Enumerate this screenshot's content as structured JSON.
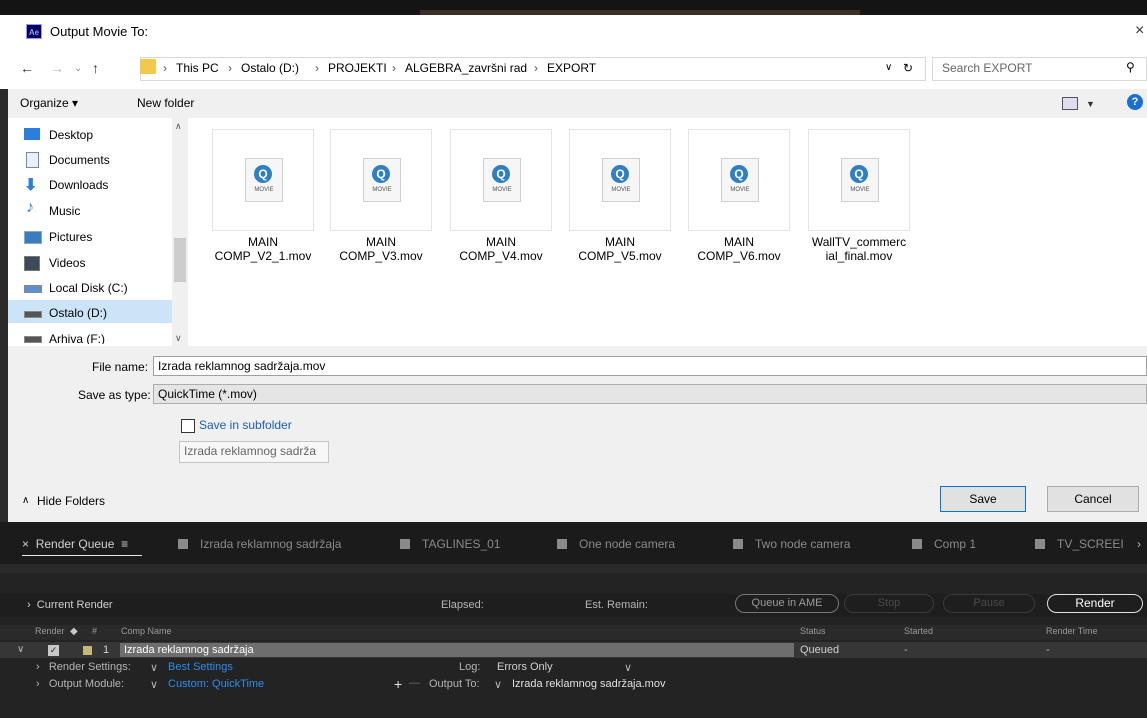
{
  "dialog": {
    "title": "Output Movie To:",
    "logo_text": "Ae",
    "close": "×",
    "breadcrumbs": [
      "This PC",
      "Ostalo (D:)",
      "PROJEKTI",
      "ALGEBRA_završni rad",
      "EXPORT"
    ],
    "search_placeholder": "Search EXPORT",
    "toolbar": {
      "organize": "Organize ▾",
      "new_folder": "New folder",
      "help": "?"
    },
    "nav": [
      {
        "label": "Desktop",
        "icon": "desktop-icon"
      },
      {
        "label": "Documents",
        "icon": "documents-icon"
      },
      {
        "label": "Downloads",
        "icon": "downloads-icon"
      },
      {
        "label": "Music",
        "icon": "music-icon"
      },
      {
        "label": "Pictures",
        "icon": "pictures-icon"
      },
      {
        "label": "Videos",
        "icon": "videos-icon"
      },
      {
        "label": "Local Disk (C:)",
        "icon": "drive-icon"
      },
      {
        "label": "Ostalo (D:)",
        "icon": "drive-icon"
      },
      {
        "label": "Arhiva (F:)",
        "icon": "drive-icon"
      }
    ],
    "files": [
      {
        "line1": "MAIN",
        "line2": "COMP_V2_1.mov"
      },
      {
        "line1": "MAIN",
        "line2": "COMP_V3.mov"
      },
      {
        "line1": "MAIN",
        "line2": "COMP_V4.mov"
      },
      {
        "line1": "MAIN",
        "line2": "COMP_V5.mov"
      },
      {
        "line1": "MAIN",
        "line2": "COMP_V6.mov"
      },
      {
        "line1": "WallTV_commerc",
        "line2": "ial_final.mov"
      }
    ],
    "movie_icon_label": "MOVIE",
    "file_name_label": "File name:",
    "file_name_value": "Izrada reklamnog sadržaja.mov",
    "save_type_label": "Save as type:",
    "save_type_value": "QuickTime (*.mov)",
    "subfolder_label": "Save in subfolder",
    "subfolder_value": "Izrada reklamnog sadrža",
    "hide_folders": "Hide Folders",
    "save": "Save",
    "cancel": "Cancel"
  },
  "render_queue": {
    "tabs": [
      "Render Queue",
      "Izrada reklamnog sadržaja",
      "TAGLINES_01",
      "One node camera",
      "Two node camera",
      "Comp 1",
      "TV_SCREEI"
    ],
    "current_render": "Current Render",
    "elapsed": "Elapsed:",
    "est_remain": "Est. Remain:",
    "queue_in_ame": "Queue in AME",
    "stop": "Stop",
    "pause": "Pause",
    "render": "Render",
    "columns": {
      "render": "Render",
      "num": "#",
      "comp_name": "Comp Name",
      "status": "Status",
      "started": "Started",
      "render_time": "Render Time"
    },
    "item": {
      "index": "1",
      "name": "Izrada reklamnog sadržaja",
      "status": "Queued",
      "started": "-",
      "render_time": "-"
    },
    "render_settings_label": "Render Settings:",
    "render_settings_value": "Best Settings",
    "log_label": "Log:",
    "log_value": "Errors Only",
    "output_module_label": "Output Module:",
    "output_module_value": "Custom: QuickTime",
    "output_to_label": "Output To:",
    "output_to_value": "Izrada reklamnog sadržaja.mov"
  }
}
